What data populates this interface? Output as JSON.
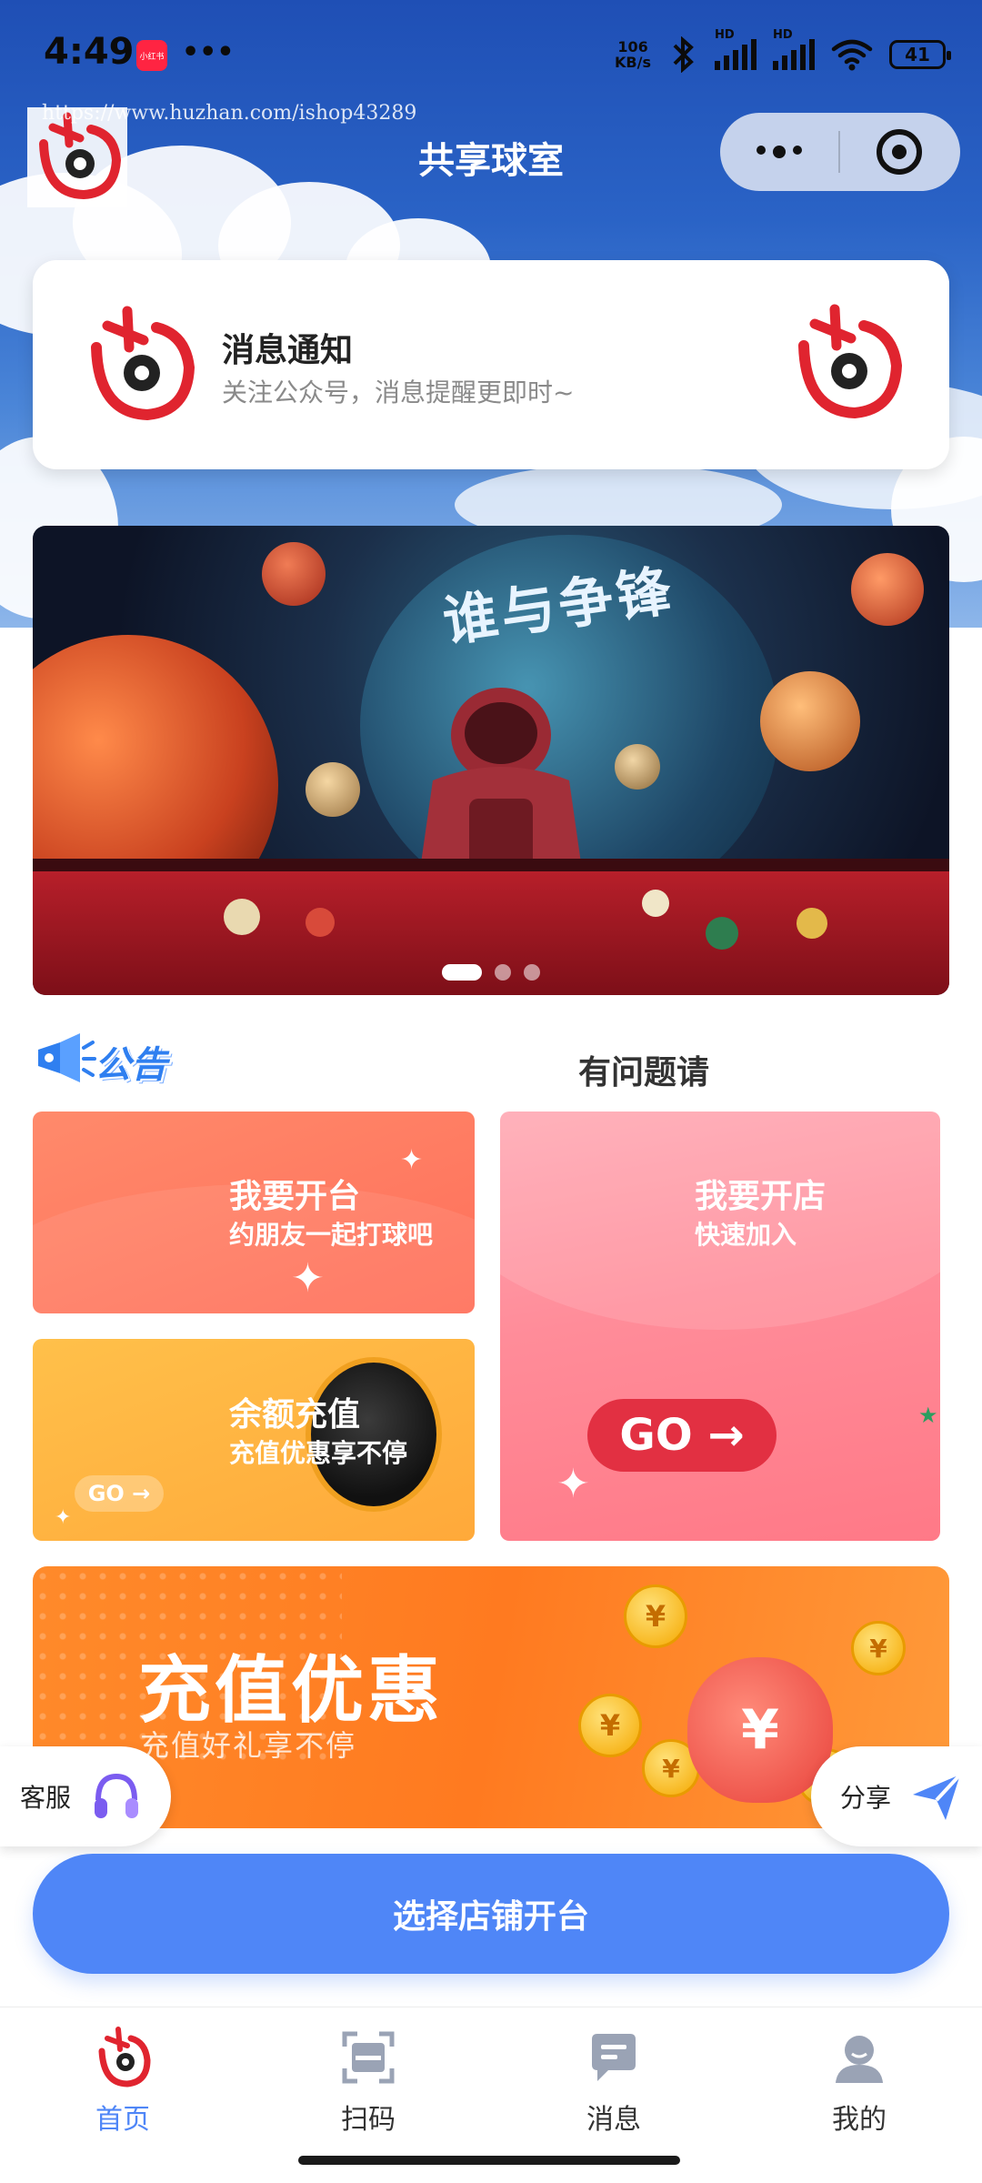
{
  "status_bar": {
    "time": "4:49",
    "app_badge": "小红书",
    "more": "•••",
    "net_speed_value": "106",
    "net_speed_unit": "KB/s",
    "signal_1_label": "HD",
    "signal_2_label": "HD",
    "battery": "41"
  },
  "header": {
    "watermark_url": "https://www.huzhan.com/ishop43289",
    "title": "共享球室"
  },
  "notice": {
    "title": "消息通知",
    "subtitle": "关注公众号，消息提醒更即时~"
  },
  "banner": {
    "overlay_text": "谁与争锋",
    "slides": 3,
    "active_slide": 1
  },
  "announcement": {
    "label": "公告",
    "scrolling_text": "有问题请"
  },
  "cards": {
    "open_table": {
      "title": "我要开台",
      "subtitle": "约朋友一起打球吧"
    },
    "open_shop": {
      "title": "我要开店",
      "subtitle": "快速加入",
      "go_label": "GO →"
    },
    "recharge": {
      "title": "余额充值",
      "subtitle": "充值优惠享不停",
      "go_label": "GO →"
    }
  },
  "promo": {
    "title": "充值优惠",
    "subtitle": "充值好礼享不停"
  },
  "floating": {
    "service_label": "客服",
    "share_label": "分享"
  },
  "cta": {
    "label": "选择店铺开台"
  },
  "tabbar": {
    "items": [
      {
        "label": "首页",
        "icon": "home-logo-icon",
        "active": true
      },
      {
        "label": "扫码",
        "icon": "scan-icon",
        "active": false
      },
      {
        "label": "消息",
        "icon": "message-icon",
        "active": false
      },
      {
        "label": "我的",
        "icon": "profile-icon",
        "active": false
      }
    ]
  },
  "colors": {
    "accent": "#4f86f7",
    "brand_red": "#e0242f"
  }
}
